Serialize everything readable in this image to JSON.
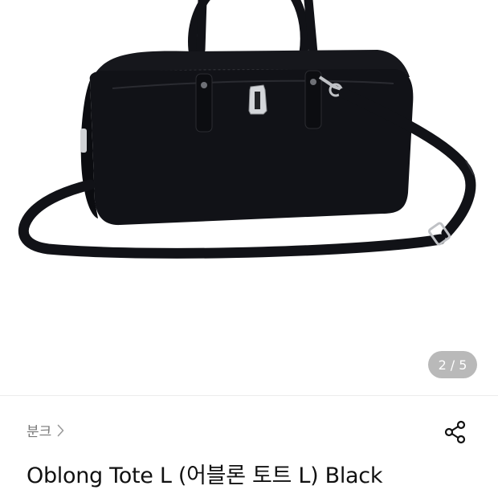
{
  "gallery": {
    "current_page": "2",
    "separator": "/",
    "total_pages": "5"
  },
  "product": {
    "brand": "분크",
    "title": "Oblong Tote L (어블론 토트 L) Black",
    "color": "#111217"
  },
  "icons": {
    "brand_chevron": "chevron-right-icon",
    "share": "share-icon"
  }
}
